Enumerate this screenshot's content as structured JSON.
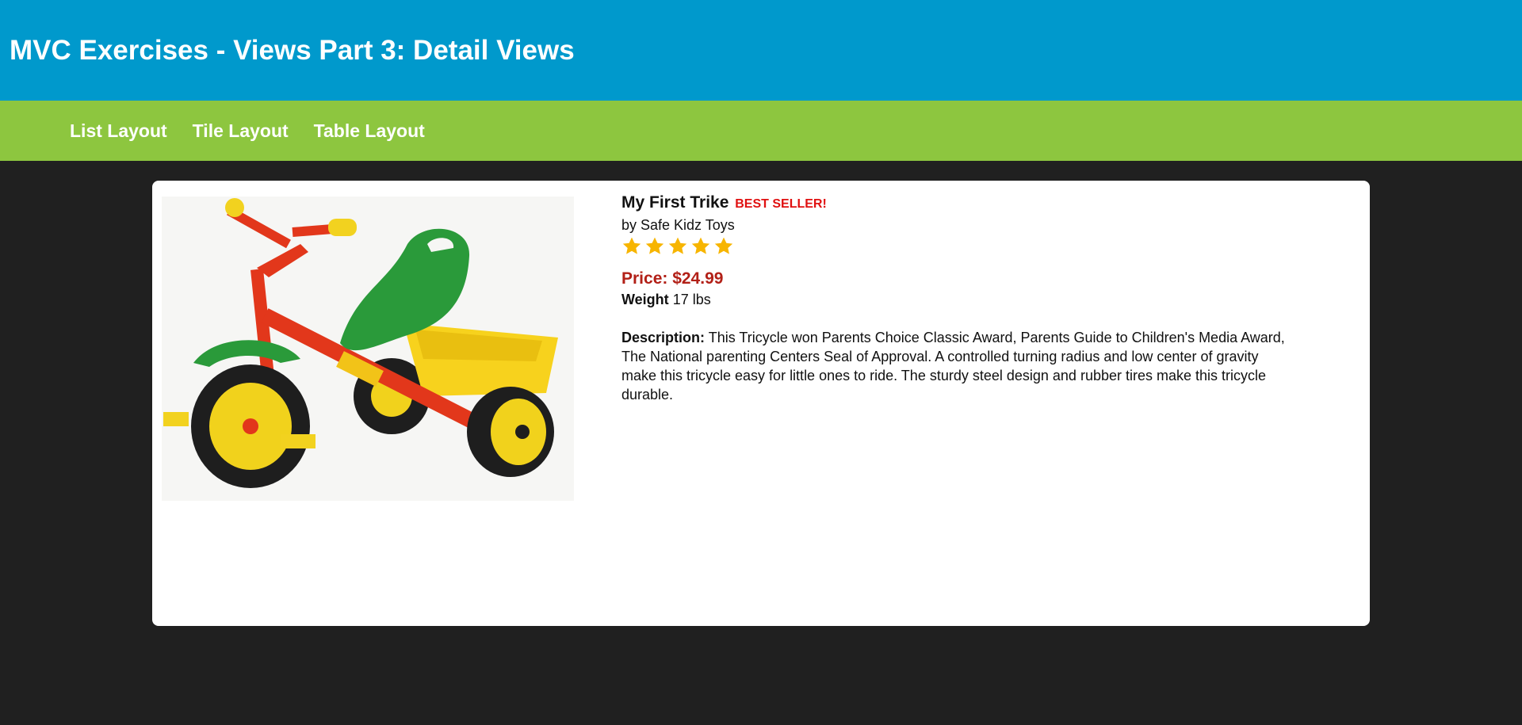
{
  "header": {
    "title": "MVC Exercises - Views Part 3: Detail Views",
    "background": "#0099cc"
  },
  "nav": {
    "background": "#8dc63f",
    "items": [
      {
        "label": "List Layout"
      },
      {
        "label": "Tile Layout"
      },
      {
        "label": "Table Layout"
      }
    ]
  },
  "product": {
    "name": "My First Trike",
    "badge": "BEST SELLER!",
    "brand": "by Safe Kidz Toys",
    "rating": 5,
    "rating_max": 5,
    "star_color": "#f7b500",
    "price_text": "Price: $24.99",
    "weight_label": "Weight",
    "weight_value": "17 lbs",
    "description_label": "Description:",
    "description": "This Tricycle won Parents Choice Classic Award, Parents Guide to Children's Media Award, The National parenting Centers Seal of Approval. A controlled turning radius and low center of gravity make this tricycle easy for little ones to ride. The sturdy steel design and rubber tires make this tricycle durable.",
    "image": {
      "subject": "tricycle-image"
    }
  }
}
